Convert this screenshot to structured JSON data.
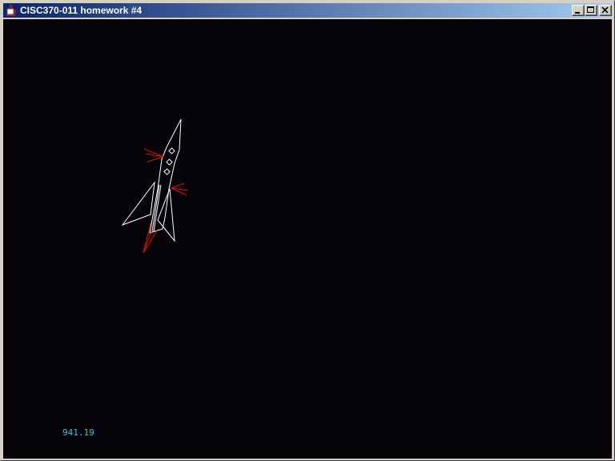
{
  "window": {
    "title": "CISC370-011 homework #4",
    "app_icon": "java-cup-icon",
    "titlebar_color": "#0a246a",
    "controls": {
      "minimize": "minimize-icon",
      "maximize": "maximize-icon",
      "close": "close-icon"
    }
  },
  "canvas": {
    "background": "#050307",
    "ship_color": "#ffffff",
    "thruster_color": "#e01010",
    "readout_color": "#49c4d6"
  },
  "readout": {
    "value": "941.19"
  }
}
